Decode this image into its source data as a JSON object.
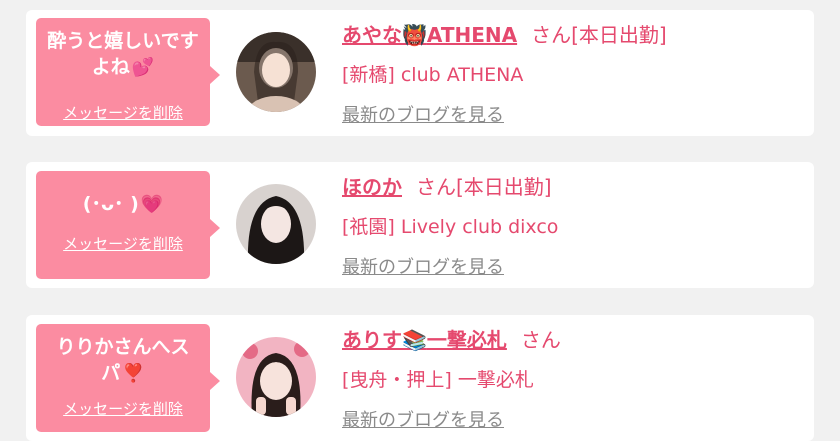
{
  "entries": [
    {
      "message": "酔うと嬉しいですよね",
      "message_emoji": "💕",
      "delete_label": "メッセージを削除",
      "name": "あやな",
      "name_emoji": "👹",
      "name_suffix": "ATHENA",
      "san": "さん",
      "status": "[本日出勤]",
      "shop": "[新橋] club ATHENA",
      "blog_label": "最新のブログを見る"
    },
    {
      "message": "(･ᴗ･ )",
      "message_emoji": "💗",
      "delete_label": "メッセージを削除",
      "name": "ほのか",
      "name_emoji": "",
      "name_suffix": "",
      "san": "さん",
      "status": "[本日出勤]",
      "shop": "[祇園] Lively club dixco",
      "blog_label": "最新のブログを見る"
    },
    {
      "message": "りりかさんへスパ",
      "message_emoji": "❣️",
      "delete_label": "メッセージを削除",
      "name": "ありす",
      "name_emoji": "📚",
      "name_suffix": "一撃必札",
      "san": "さん",
      "status": "",
      "shop": "[曳舟・押上] 一撃必札",
      "blog_label": "最新のブログを見る"
    }
  ],
  "colors": {
    "bubble": "#fb8ca1",
    "accent": "#e5496e",
    "link_gray": "#8a8a8a",
    "background": "#f1f1f1"
  }
}
